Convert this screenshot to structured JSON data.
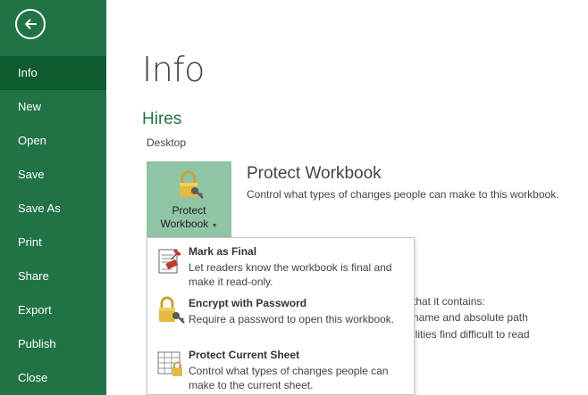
{
  "sidebar": {
    "back_label": "Back",
    "items": [
      {
        "label": "Info",
        "active": true
      },
      {
        "label": "New"
      },
      {
        "label": "Open"
      },
      {
        "label": "Save"
      },
      {
        "label": "Save As"
      },
      {
        "label": "Print"
      },
      {
        "label": "Share"
      },
      {
        "label": "Export"
      },
      {
        "label": "Publish"
      },
      {
        "label": "Close"
      }
    ]
  },
  "main": {
    "title": "Info",
    "file_name": "Hires",
    "file_location": "Desktop",
    "protect": {
      "button_line1": "Protect",
      "button_line2": "Workbook",
      "section_title": "Protect Workbook",
      "section_desc": "Control what types of changes people can make to this workbook."
    },
    "background_lines": [
      "that it contains:",
      "name and absolute path",
      "ilities find difficult to read"
    ]
  },
  "dropdown": {
    "items": [
      {
        "title": "Mark as Final",
        "desc": "Let readers know the workbook is final and make it read-only."
      },
      {
        "title": "Encrypt with Password",
        "desc": "Require a password to open this workbook."
      },
      {
        "title": "Protect Current Sheet",
        "desc": "Control what types of changes people can make to the current sheet."
      }
    ]
  },
  "colors": {
    "brand_green": "#217346",
    "active_nav": "#0e5c2f",
    "protect_button_bg": "#8fc4a4"
  }
}
